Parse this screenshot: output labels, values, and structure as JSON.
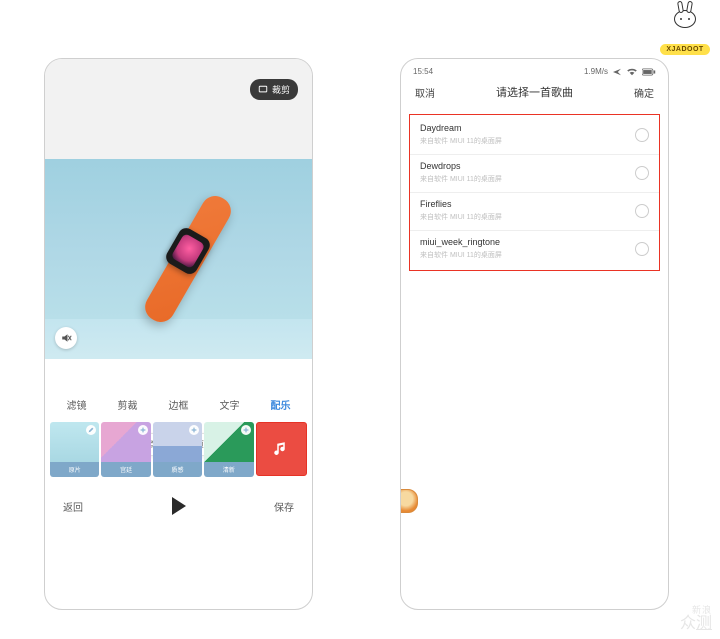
{
  "mascot": {
    "tag_text": "XJADOOT"
  },
  "watermark": {
    "line1": "新浪",
    "line2_a": "众",
    "line2_b": "测"
  },
  "left_phone": {
    "crop_pill": "裁剪",
    "tabs": [
      "滤镜",
      "剪裁",
      "边框",
      "文字",
      "配乐"
    ],
    "tooltip": "点某项收推荐页",
    "thumbs": [
      {
        "label": "原片"
      },
      {
        "label": "宫廷"
      },
      {
        "label": "质感"
      },
      {
        "label": "清新"
      }
    ],
    "bottom": {
      "back": "返回",
      "save": "保存"
    }
  },
  "right_phone": {
    "status": {
      "time": "15:54",
      "speed": "1.9M/s"
    },
    "titlebar": {
      "left": "取消",
      "center": "请选择一首歌曲",
      "right": "确定"
    },
    "songs": [
      {
        "name": "Daydream",
        "sub": "来自软件 MIUI 11的桌面屏"
      },
      {
        "name": "Dewdrops",
        "sub": "来自软件 MIUI 11的桌面屏"
      },
      {
        "name": "Fireflies",
        "sub": "来自软件 MIUI 11的桌面屏"
      },
      {
        "name": "miui_week_ringtone",
        "sub": "来自软件 MIUI 11的桌面屏"
      }
    ]
  }
}
